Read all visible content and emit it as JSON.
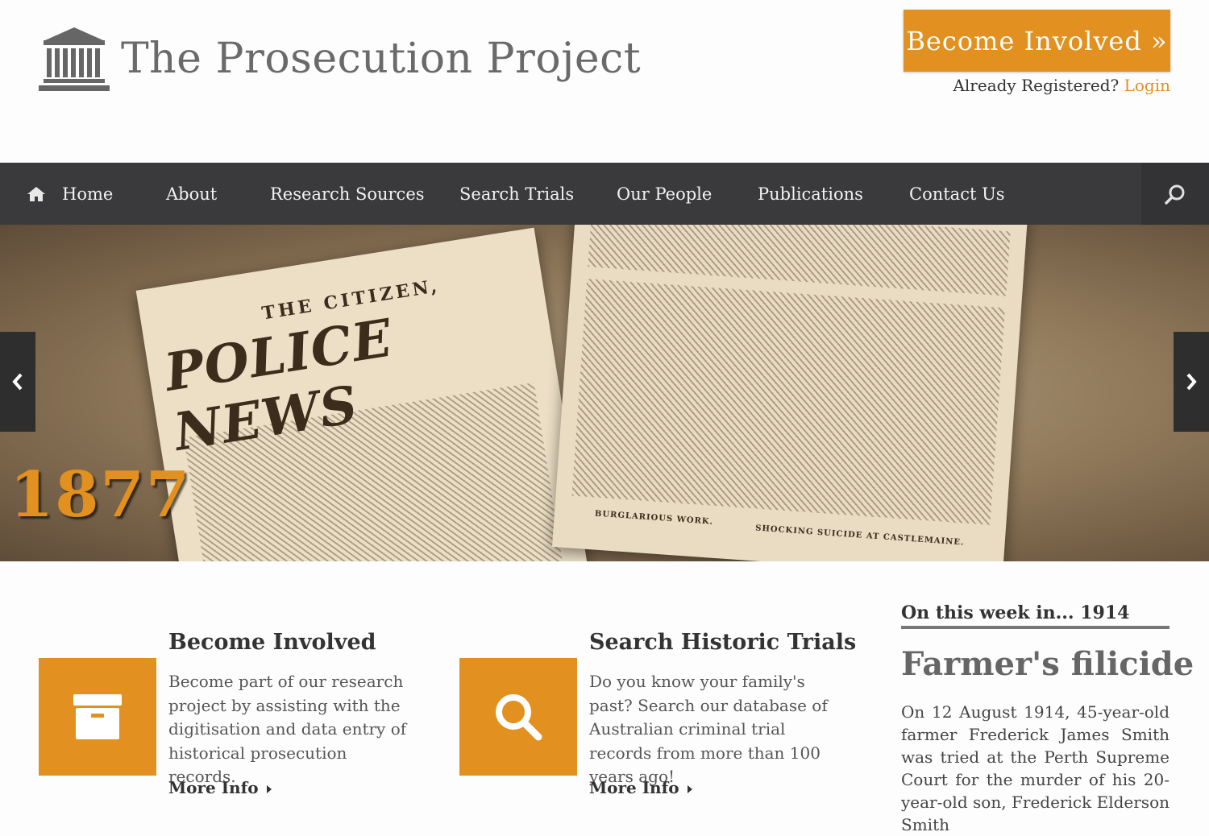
{
  "site": {
    "title": "The Prosecution Project"
  },
  "header": {
    "cta_label": "Become Involved »",
    "already_text": "Already Registered?",
    "login_label": "Login"
  },
  "nav": {
    "items": [
      {
        "label": "Home",
        "icon": "home-icon"
      },
      {
        "label": "About"
      },
      {
        "label": "Research Sources"
      },
      {
        "label": "Search Trials"
      },
      {
        "label": "Our People"
      },
      {
        "label": "Publications"
      },
      {
        "label": "Contact Us"
      }
    ],
    "search_icon": "search-icon"
  },
  "hero": {
    "year": "1877",
    "paper_masthead_small": "THE CITIZEN,",
    "paper_masthead": "POLICE NEWS",
    "caption_left": "BURGLARIOUS WORK.",
    "caption_right": "SHOCKING SUICIDE AT CASTLEMAINE."
  },
  "features": [
    {
      "title": "Become Involved",
      "icon": "archive-box-icon",
      "description": "Become part of our research project by assisting with the digitisation and data entry of historical prosecution records.",
      "more": "More Info"
    },
    {
      "title": "Search Historic Trials",
      "icon": "search-icon",
      "description": "Do you know your family's past? Search our database of Australian criminal trial records from more than 100 years ago!",
      "more": "More Info"
    }
  ],
  "sidebar": {
    "heading": "On this week in... 1914",
    "title": "Farmer's filicide",
    "text": "On 12 August 1914, 45-year-old farmer Frederick James Smith was tried at the Perth Supreme Court for the murder of his 20-year-old son, Frederick Elderson Smith"
  },
  "colors": {
    "accent": "#e2901f",
    "nav_bg": "#3a3a3c"
  }
}
